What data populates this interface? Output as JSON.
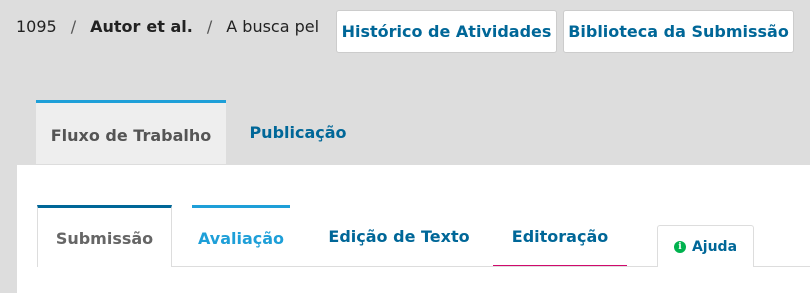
{
  "breadcrumb": {
    "id": "1095",
    "author_name": "Autor",
    "author_suffix": "et al.",
    "title": "A busca pel"
  },
  "header_buttons": {
    "history": "Histórico de Atividades",
    "library": "Biblioteca da Submissão"
  },
  "main_tabs": [
    {
      "label": "Fluxo de Trabalho",
      "active": true
    },
    {
      "label": "Publicação",
      "active": false
    }
  ],
  "stage_tabs": [
    {
      "label": "Submissão",
      "active": true
    },
    {
      "label": "Avaliação"
    },
    {
      "label": "Edição de Texto"
    },
    {
      "label": "Editoração"
    }
  ],
  "help": {
    "label": "Ajuda",
    "icon": "info-icon",
    "icon_glyph": "i"
  },
  "colors": {
    "link": "#006798",
    "accent": "#1e9fd8",
    "underline": "#d00a6c",
    "help_icon": "#00b24e"
  }
}
